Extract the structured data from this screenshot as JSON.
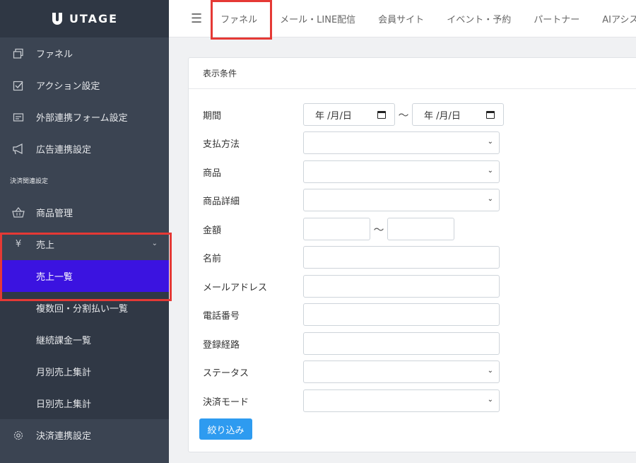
{
  "app": {
    "logo_text": "UTAGE"
  },
  "topnav": {
    "tabs": [
      "ファネル",
      "メール・LINE配信",
      "会員サイト",
      "イベント・予約",
      "パートナー",
      "AIアシス"
    ]
  },
  "sidebar": {
    "items": [
      {
        "label": "ファネル",
        "icon": "funnel-icon"
      },
      {
        "label": "アクション設定",
        "icon": "checkbox-icon"
      },
      {
        "label": "外部連携フォーム設定",
        "icon": "form-icon"
      },
      {
        "label": "広告連携設定",
        "icon": "megaphone-icon"
      }
    ],
    "section_label": "決済関連設定",
    "product_label": "商品管理",
    "sales_label": "売上",
    "sales_symbol": "¥",
    "sub_items": [
      "売上一覧",
      "複数回・分割払い一覧",
      "継続課金一覧",
      "月別売上集計",
      "日別売上集計"
    ],
    "settings_label": "決済連携設定"
  },
  "filter": {
    "title": "表示条件",
    "labels": {
      "period": "期間",
      "payment_method": "支払方法",
      "product": "商品",
      "product_detail": "商品詳細",
      "amount": "金額",
      "name": "名前",
      "email": "メールアドレス",
      "phone": "電話番号",
      "route": "登録経路",
      "status": "ステータス",
      "mode": "決済モード"
    },
    "date_placeholder": "年 /月/日",
    "range_sep": "〜",
    "submit_label": "絞り込み"
  }
}
